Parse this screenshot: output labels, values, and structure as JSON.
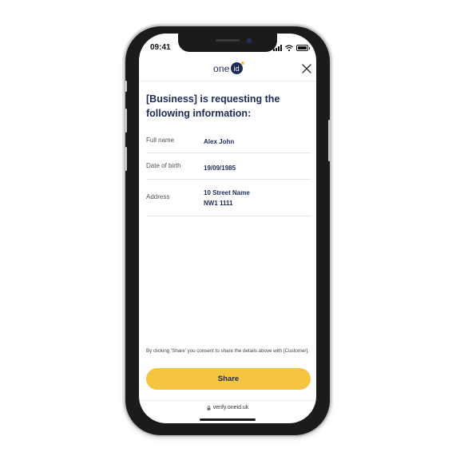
{
  "status_bar": {
    "time": "09:41"
  },
  "header": {
    "logo_text": "one",
    "logo_badge": "id",
    "close_label": "Close"
  },
  "heading": "[Business] is requesting the following information:",
  "fields": [
    {
      "label": "Full name",
      "value_lines": [
        "Alex John"
      ]
    },
    {
      "label": "Date of birth",
      "value_lines": [
        "19/09/1985"
      ]
    },
    {
      "label": "Address",
      "value_lines": [
        "10 Street Name",
        "NW1 1111"
      ]
    }
  ],
  "consent_text": "By clicking 'Share' you consent to share the details above with [Customer].",
  "share_label": "Share",
  "url": "verify.oneid.uk",
  "colors": {
    "brand": "#1d2a57",
    "accent": "#f5c542"
  }
}
